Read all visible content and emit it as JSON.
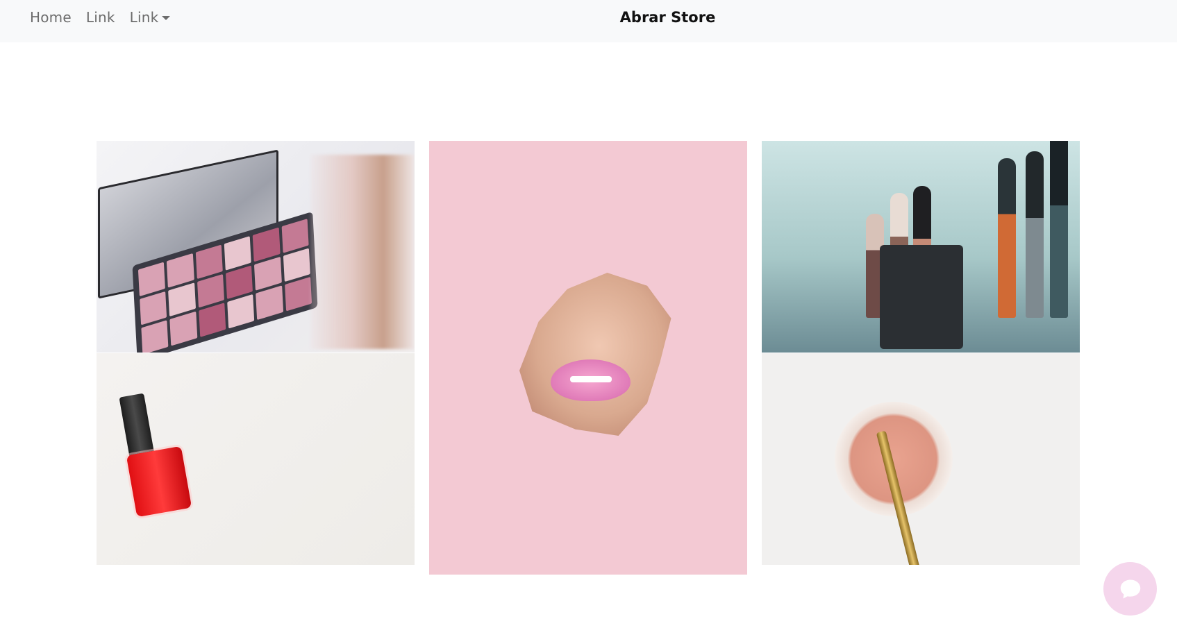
{
  "navbar": {
    "links": [
      {
        "label": "Home"
      },
      {
        "label": "Link"
      },
      {
        "label": "Link",
        "has_dropdown": true
      }
    ],
    "brand": "Abrar Store"
  },
  "gallery": {
    "images": [
      {
        "name": "eyeshadow-palette"
      },
      {
        "name": "lips-through-paper"
      },
      {
        "name": "makeup-brushes-jar"
      },
      {
        "name": "red-nail-polish"
      },
      {
        "name": "powder-with-brush"
      }
    ]
  },
  "chat": {
    "icon": "chat-bubble-icon",
    "color": "#f5d6ec"
  },
  "colors": {
    "navbar_bg": "#f8f9fa",
    "nav_text": "#6c6c6c",
    "brand_text": "#111111"
  }
}
